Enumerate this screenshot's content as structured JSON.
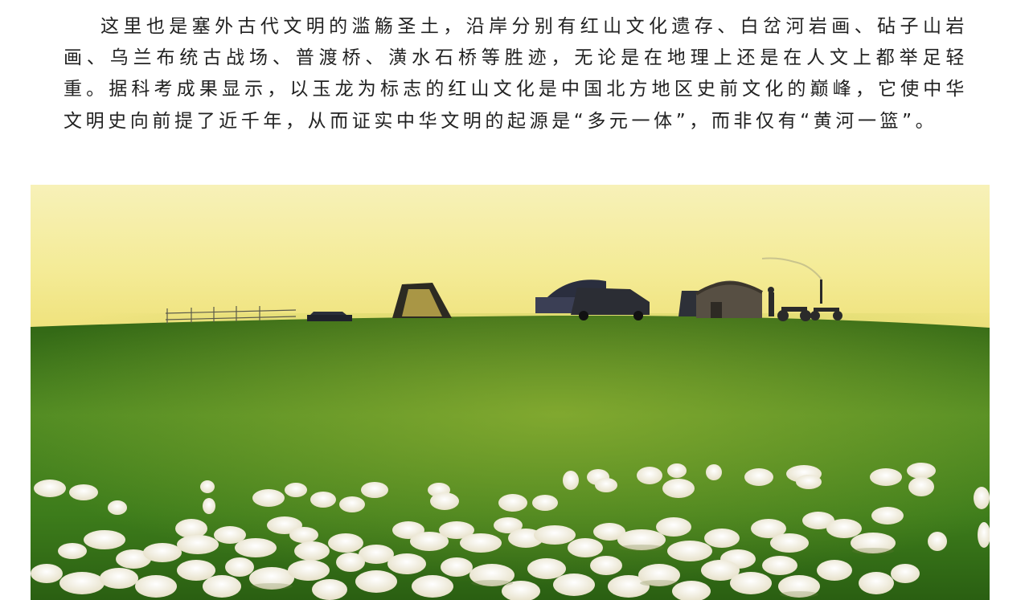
{
  "article": {
    "paragraph": "这里也是塞外古代文明的滥觞圣土，沿岸分别有红山文化遗存、白岔河岩画、砧子山岩画、乌兰布统古战场、普渡桥、潢水石桥等胜迹，无论是在地理上还是在人文上都举足轻重。据科考成果显示，以玉龙为标志的红山文化是中国北方地区史前文化的巅峰，它使中华文明史向前提了近千年，从而证实中华文明的起源是“多元一体”，而非仅有“黄河一篮”。"
  },
  "photo": {
    "subject": "grassland-with-sheep-yurts-and-vehicles",
    "sky_color": "#f7efb0",
    "grass_color": "#3f7d1f"
  }
}
